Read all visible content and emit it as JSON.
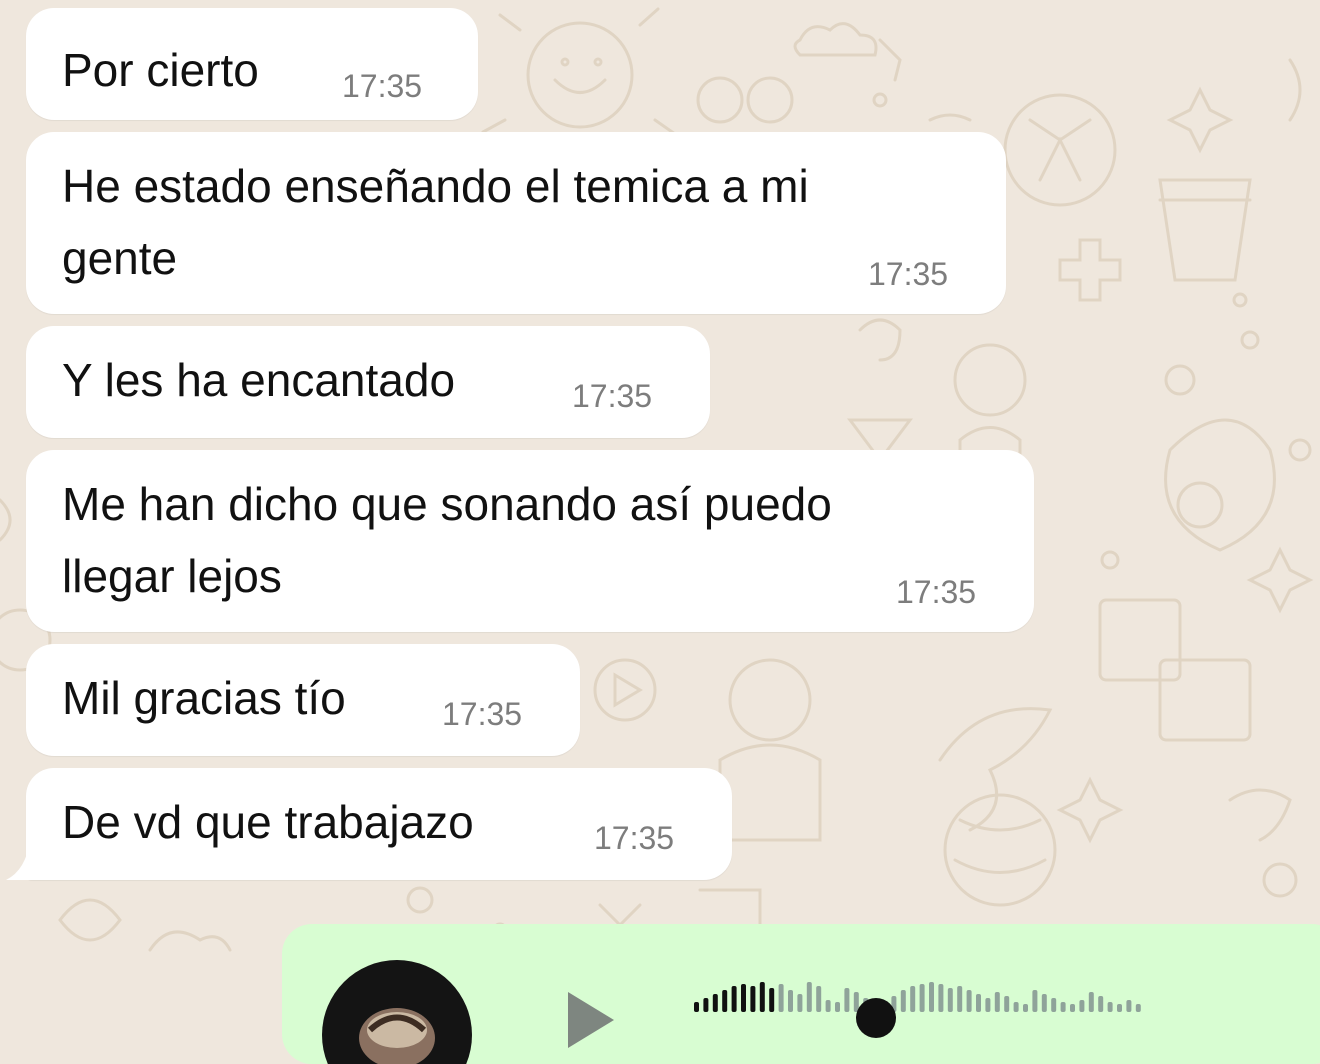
{
  "chat": {
    "messages": [
      {
        "text": "Por cierto",
        "time": "17:35"
      },
      {
        "line1": "He estado enseñando el temica a mi",
        "line2": "gente",
        "time": "17:35"
      },
      {
        "text": "Y les ha encantado",
        "time": "17:35"
      },
      {
        "line1": "Me han dicho que sonando así puedo",
        "line2": "llegar lejos",
        "time": "17:35"
      },
      {
        "text": "Mil gracias tío",
        "time": "17:35"
      },
      {
        "text": "De vd que trabajazo",
        "time": "17:35"
      }
    ],
    "voice_message": {
      "play_icon": "play-icon",
      "progress": 0.18,
      "colors": {
        "bubble": "#d8fdd2",
        "played": "#111111",
        "unplayed": "#8fa39a"
      }
    }
  },
  "colors": {
    "wallpaper": "#efe7dd",
    "bubble_incoming": "#ffffff",
    "timestamp": "#7d7d7d"
  }
}
